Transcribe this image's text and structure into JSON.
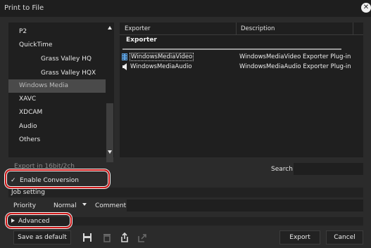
{
  "window": {
    "title": "Print to File",
    "close_glyph": "✕"
  },
  "categories": {
    "items": [
      {
        "label": "P2",
        "level": 1
      },
      {
        "label": "QuickTime",
        "level": 1
      },
      {
        "label": "Grass Valley HQ",
        "level": 2
      },
      {
        "label": "Grass Valley HQX",
        "level": 2
      },
      {
        "label": "Windows Media",
        "level": 1,
        "selected": true
      },
      {
        "label": "XAVC",
        "level": 1
      },
      {
        "label": "XDCAM",
        "level": 1
      },
      {
        "label": "Audio",
        "level": 1
      },
      {
        "label": "Others",
        "level": 1
      }
    ]
  },
  "exporters": {
    "col_exporter": "Exporter",
    "col_description": "Description",
    "group": "Exporter",
    "rows": [
      {
        "name": "WindowsMediaVideo",
        "description": "WindowsMediaVideo Exporter Plug-in",
        "icon": "film-icon",
        "selected": true
      },
      {
        "name": "WindowsMediaAudio",
        "description": "WindowsMediaAudio Exporter Plug-in",
        "icon": "speaker-icon"
      }
    ]
  },
  "options": {
    "export_16bit": "Export in 16bit/2ch",
    "enable_conversion": "Enable Conversion",
    "enable_conversion_checked": true,
    "search_label": "Search",
    "search_value": ""
  },
  "job": {
    "section_label": "Job setting",
    "priority_label": "Priority",
    "priority_value": "Normal",
    "comment_label": "Comment",
    "comment_value": ""
  },
  "advanced": {
    "label": "Advanced"
  },
  "buttons": {
    "save_default": "Save as default",
    "export": "Export",
    "cancel": "Cancel"
  },
  "toolbar_icons": [
    "save-icon",
    "delete-icon",
    "import-icon",
    "export-icon"
  ],
  "colors": {
    "highlight_ring": "#d01818",
    "selected_item": "#4a4a4a",
    "panel_bg": "#1f1f1f"
  }
}
